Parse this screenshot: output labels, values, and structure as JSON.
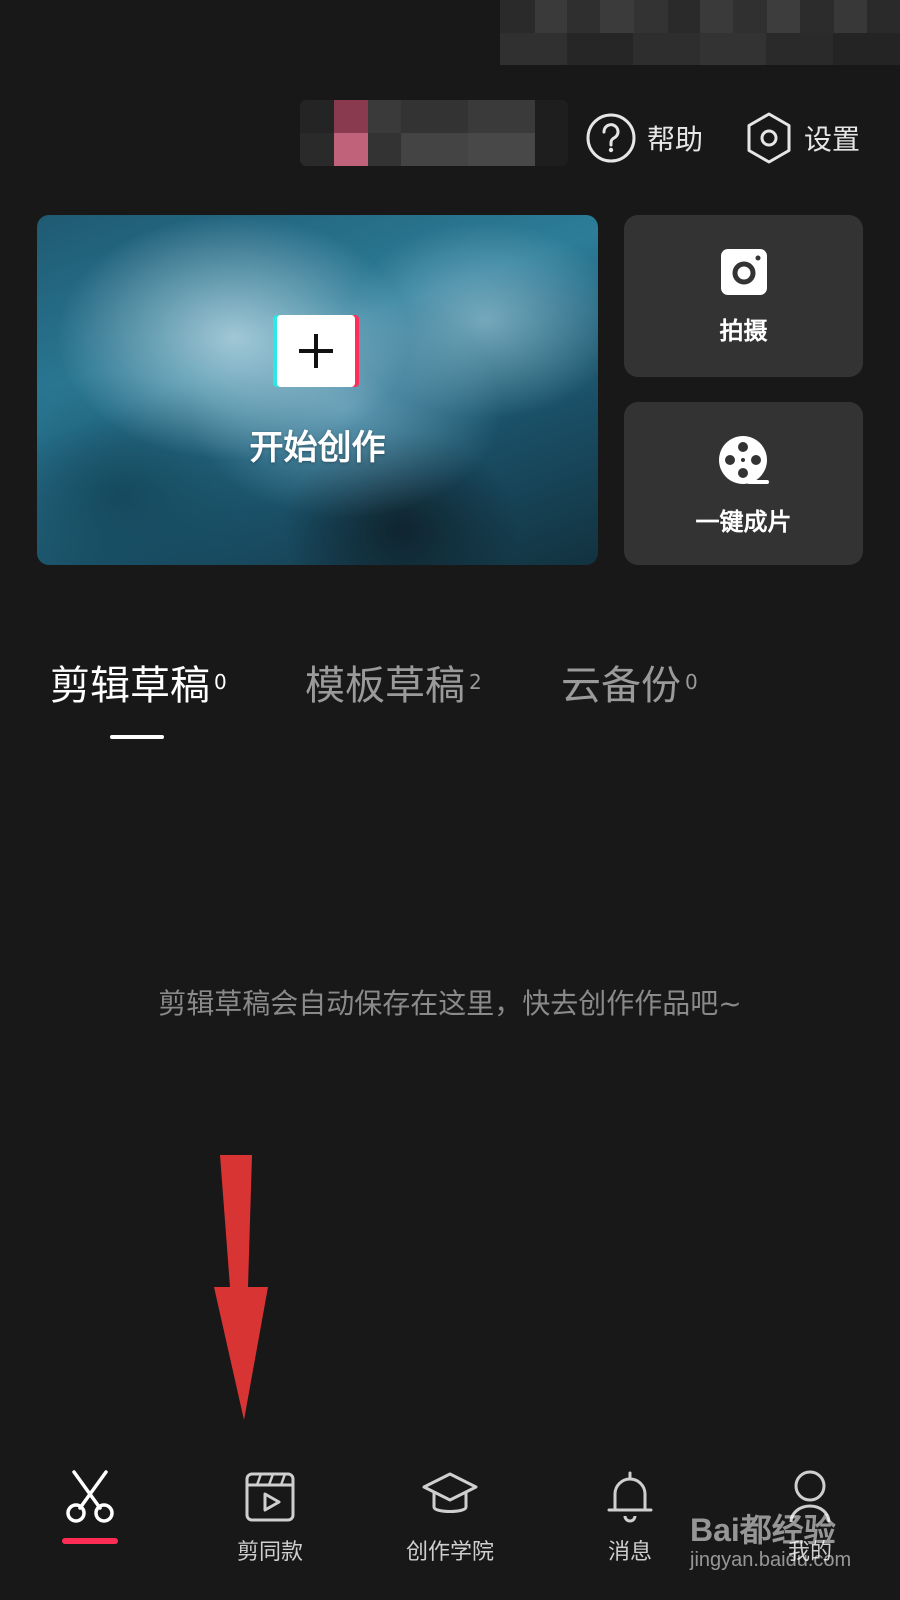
{
  "header": {
    "help_label": "帮助",
    "settings_label": "设置"
  },
  "create_card": {
    "label": "开始创作"
  },
  "quick_actions": [
    {
      "label": "拍摄",
      "icon": "camera-icon"
    },
    {
      "label": "一键成片",
      "icon": "film-reel-icon"
    }
  ],
  "tabs": [
    {
      "label": "剪辑草稿",
      "count": "0",
      "active": true
    },
    {
      "label": "模板草稿",
      "count": "2",
      "active": false
    },
    {
      "label": "云备份",
      "count": "0",
      "active": false
    }
  ],
  "empty_state": {
    "message": "剪辑草稿会自动保存在这里，快去创作作品吧~"
  },
  "bottom_nav": [
    {
      "label": "",
      "icon": "scissors-icon",
      "active": true
    },
    {
      "label": "剪同款",
      "icon": "template-video-icon",
      "active": false
    },
    {
      "label": "创作学院",
      "icon": "graduation-cap-icon",
      "active": false
    },
    {
      "label": "消息",
      "icon": "bell-icon",
      "active": false
    },
    {
      "label": "我的",
      "icon": "profile-icon",
      "active": false
    }
  ],
  "watermark": {
    "logo": "Bai都经验",
    "url": "jingyan.baidu.com"
  },
  "colors": {
    "background": "#181818",
    "card": "#333333",
    "accent": "#ff2d55",
    "annotation_arrow": "#d93434"
  }
}
